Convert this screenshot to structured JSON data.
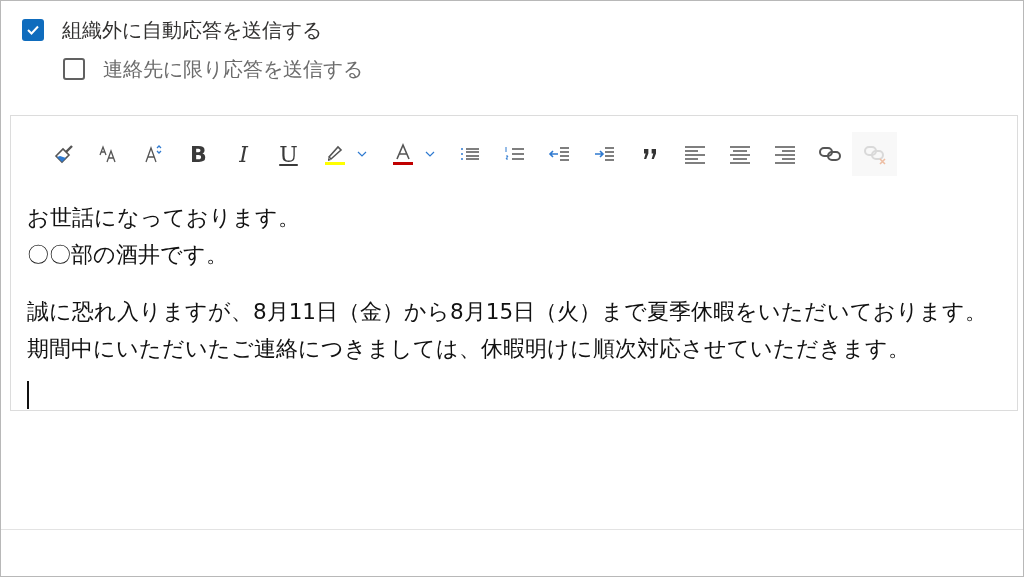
{
  "options": [
    {
      "label": "組織外に自動応答を送信する",
      "checked": true
    },
    {
      "label": "連絡先に限り応答を送信する",
      "checked": false
    }
  ],
  "toolbar": [
    {
      "kind": "painter",
      "disabled": false
    },
    {
      "kind": "fontsize",
      "disabled": false
    },
    {
      "kind": "grow",
      "disabled": false
    },
    {
      "kind": "bold",
      "label": "B",
      "disabled": false
    },
    {
      "kind": "italic",
      "label": "I",
      "disabled": false
    },
    {
      "kind": "underline",
      "label": "U",
      "disabled": false
    },
    {
      "kind": "highlight",
      "color": "#ffff00",
      "disabled": false
    },
    {
      "kind": "fontcolor",
      "color": "#c00000",
      "disabled": false
    },
    {
      "kind": "bullets",
      "disabled": false
    },
    {
      "kind": "numbering",
      "disabled": false
    },
    {
      "kind": "outdent",
      "disabled": false
    },
    {
      "kind": "indent",
      "disabled": false
    },
    {
      "kind": "quote",
      "disabled": false
    },
    {
      "kind": "alignleft",
      "disabled": false
    },
    {
      "kind": "aligncenter",
      "disabled": false
    },
    {
      "kind": "alignright",
      "disabled": false
    },
    {
      "kind": "link",
      "disabled": false
    },
    {
      "kind": "unlink",
      "disabled": true
    }
  ],
  "body": {
    "paragraphs": [
      [
        "お世話になっております。",
        "〇〇部の酒井です。"
      ],
      [
        "誠に恐れ入りますが、8月11日（金）から8月15日（火）まで夏季休暇をいただいております。",
        "期間中にいただいたご連絡につきましては、休暇明けに順次対応させていただきます。"
      ]
    ],
    "cursor": true
  }
}
